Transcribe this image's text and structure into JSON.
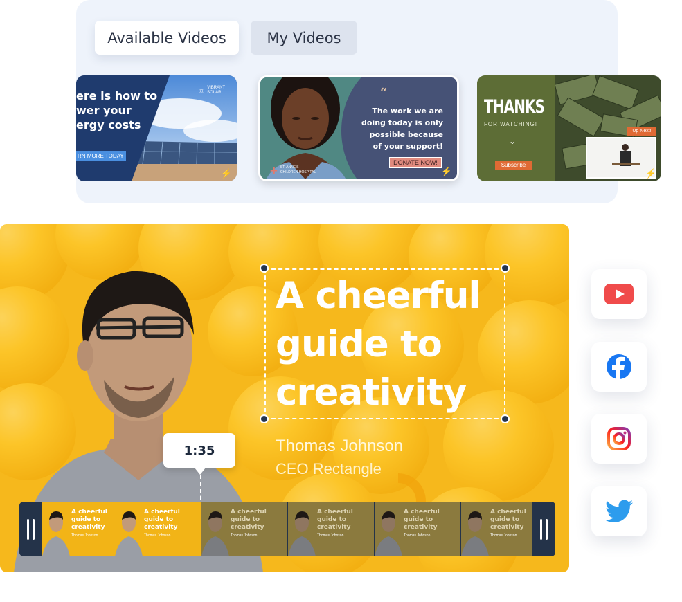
{
  "tabs": {
    "available_label": "Available Videos",
    "my_label": "My Videos"
  },
  "thumbnails": {
    "solar": {
      "headline_1": "ere is how to",
      "headline_2": "wer your",
      "headline_3": "ergy costs",
      "cta": "RN MORE TODAY",
      "brand_1": "VIBRANT",
      "brand_2": "SOLAR"
    },
    "hospital": {
      "quote_mark": "“",
      "line_1": "The work we are",
      "line_2": "doing today is only",
      "line_3": "possible because",
      "line_4": "of your support!",
      "cta": "DONATE NOW!",
      "org_1": "ST. ANNE'S",
      "org_2": "CHILDREN HOSPITAL"
    },
    "thanks": {
      "title": "THANKS",
      "subtitle": "FOR WATCHING!",
      "cta": "Subscribe",
      "upnext": "Up Next!"
    }
  },
  "editor": {
    "headline_1": "A cheerful",
    "headline_2": "guide to",
    "headline_3": "creativity",
    "name": "Thomas Johnson",
    "role": "CEO Rectangle",
    "time": "1:35"
  },
  "timeline": {
    "frame_line_1": "A cheerful",
    "frame_line_2": "guide to",
    "frame_line_3": "creativity",
    "frame_sub": "Thomas Johnson"
  },
  "social": [
    "youtube-icon",
    "facebook-icon",
    "instagram-icon",
    "twitter-icon"
  ],
  "colors": {
    "accent_yellow": "#F6B81C",
    "navy": "#243349",
    "youtube": "#F04B4B",
    "facebook": "#1877F2",
    "twitter": "#2D9CED"
  }
}
